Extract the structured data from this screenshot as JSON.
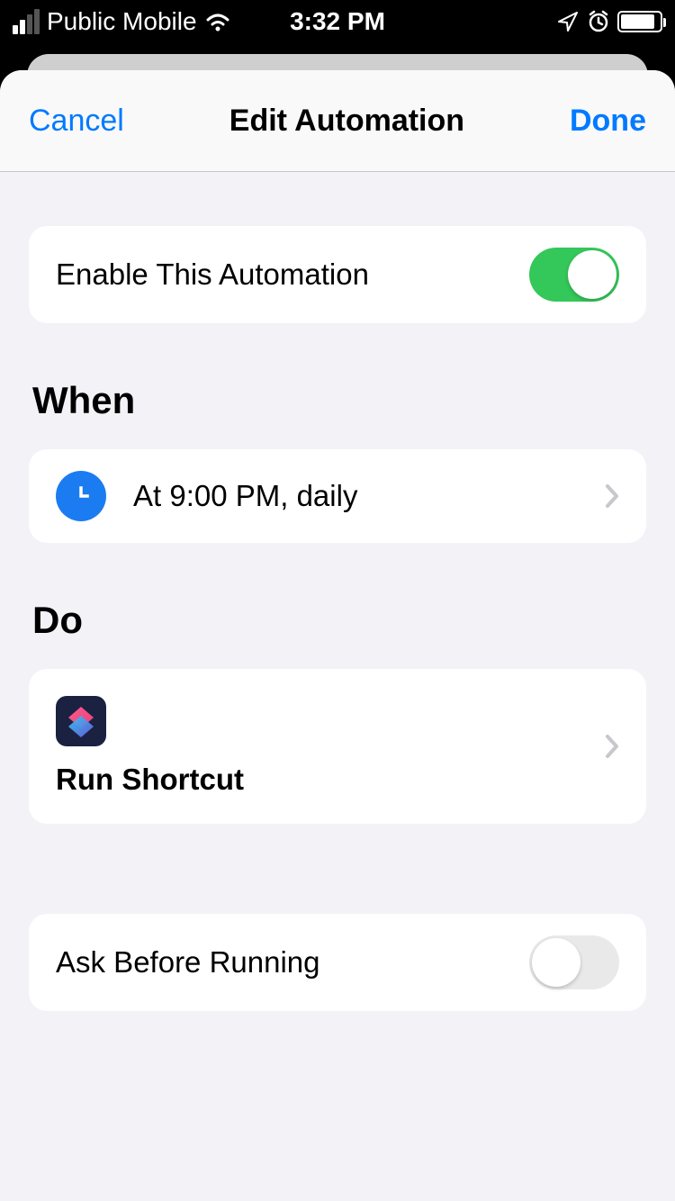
{
  "status": {
    "carrier": "Public Mobile",
    "time": "3:32 PM"
  },
  "nav": {
    "cancel": "Cancel",
    "title": "Edit Automation",
    "done": "Done"
  },
  "enable": {
    "label": "Enable This Automation",
    "on": true
  },
  "when": {
    "header": "When",
    "text": "At 9:00 PM, daily"
  },
  "do": {
    "header": "Do",
    "text": "Run Shortcut"
  },
  "ask": {
    "label": "Ask Before Running",
    "on": false
  }
}
